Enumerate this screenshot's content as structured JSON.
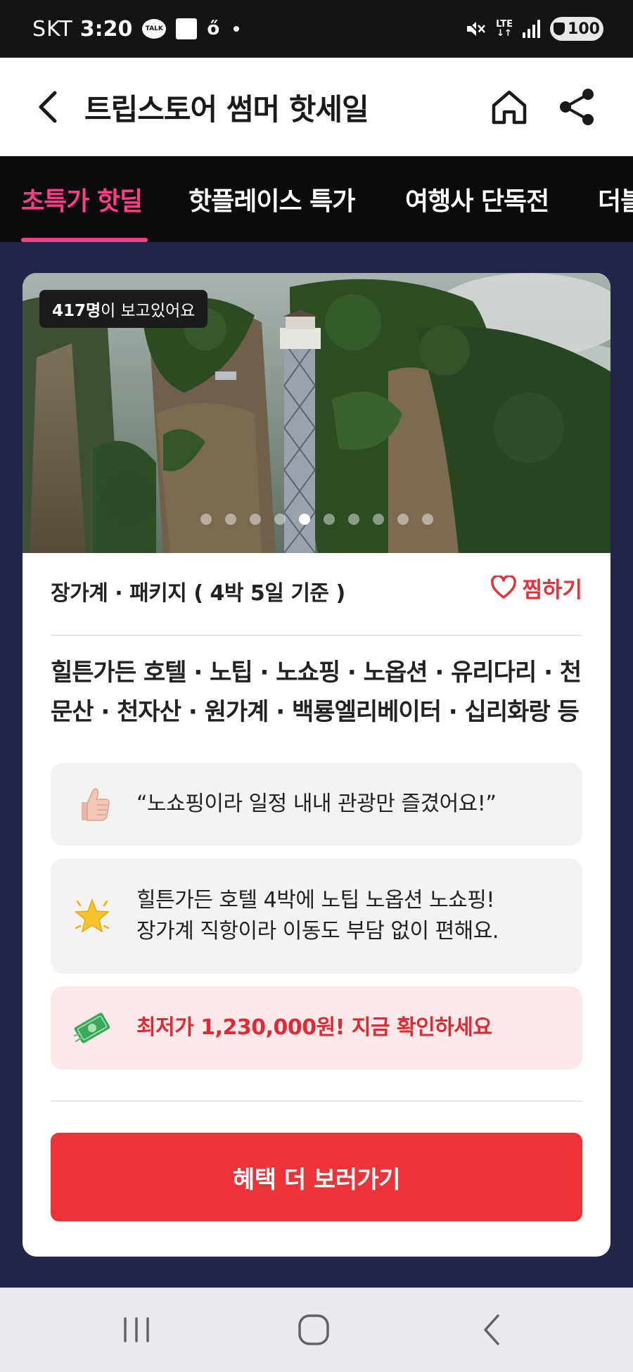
{
  "status_bar": {
    "carrier": "SKT",
    "time": "3:20",
    "talk_label": "TALK",
    "lte_label": "LTE",
    "battery": "100"
  },
  "header": {
    "title": "트립스토어 썸머 핫세일"
  },
  "tabs": [
    {
      "label": "초특가 핫딜",
      "active": true
    },
    {
      "label": "핫플레이스 특가",
      "active": false
    },
    {
      "label": "여행사 단독전",
      "active": false
    },
    {
      "label": "더블",
      "active": false
    }
  ],
  "card": {
    "viewer_count": "417명",
    "viewer_suffix": "이 보고있어요",
    "carousel_current": 5,
    "carousel_total": 10,
    "destination": "장가계 · 패키지 ( 4박 5일 기준 )",
    "wish_label": "찜하기",
    "highlights": "힐튼가든 호텔 · 노팁 · 노쇼핑 · 노옵션 · 유리다리 · 천문산 · 천자산 · 원가계 · 백룡엘리베이터 · 십리화랑 등",
    "review_quote": "“노쇼핑이라 일정 내내 관광만 즐겼어요!”",
    "feature_line1": "힐튼가든 호텔 4박에 노팁 노옵션 노쇼핑!",
    "feature_line2": "장가계 직항이라 이동도 부담 없이 편해요.",
    "price_text": "최저가 1,230,000원! 지금 확인하세요",
    "cta_label": "혜택 더 보러가기"
  },
  "colors": {
    "accent_pink": "#ff3d88",
    "cta_red": "#ed3338",
    "page_bg": "#23244a"
  }
}
